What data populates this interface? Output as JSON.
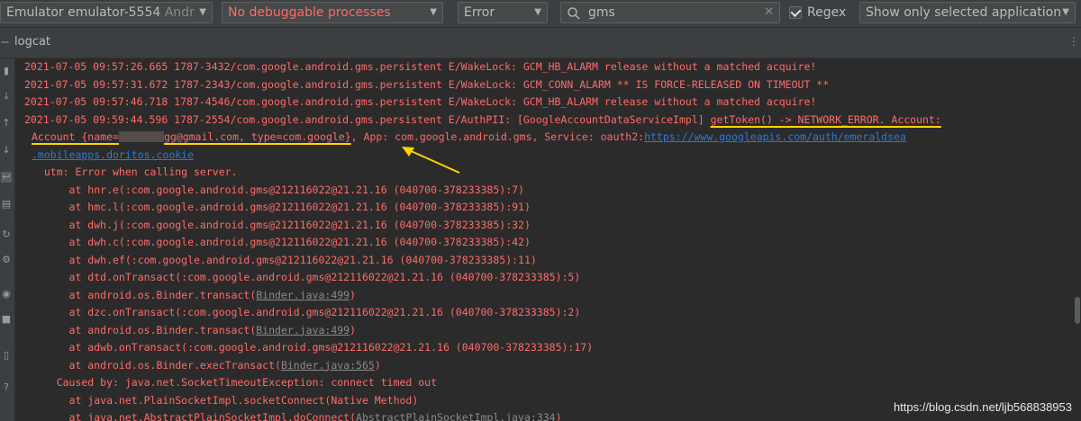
{
  "toolbar": {
    "device": "Emulator emulator-5554",
    "device_suffix": "Andr",
    "process": "No debuggable processes",
    "level": "Error",
    "search_value": "gms",
    "regex_label": "Regex",
    "filter": "Show only selected application"
  },
  "panel": {
    "tab_label": "logcat",
    "hide_glyph": "−"
  },
  "log": {
    "l1": "2021-07-05 09:57:26.665 1787-3432/com.google.android.gms.persistent E/WakeLock: GCM_HB_ALARM release without a matched acquire!",
    "l2": "2021-07-05 09:57:31.672 1787-2343/com.google.android.gms.persistent E/WakeLock: GCM_CONN_ALARM ** IS FORCE-RELEASED ON TIMEOUT **",
    "l3": "2021-07-05 09:57:46.718 1787-4546/com.google.android.gms.persistent E/WakeLock: GCM_HB_ALARM release without a matched acquire!",
    "l4a": "2021-07-05 09:59:44.596 1787-2554/com.google.android.gms.persistent E/AuthPII: [GoogleAccountDataServiceImpl] ",
    "l4b": "getToken() -> NETWORK_ERROR. Account:",
    "l5a": "Account {name=",
    "l5b": "gg@gmail.com, type=com.google}",
    "l5c": ", App: com.google.android.gms, Service: oauth2:",
    "l5link": "https://www.googleapis.com/auth/emeraldsea",
    "l6link": ".mobileapps.doritos.cookie",
    "l7": "  utm: Error when calling server.",
    "l8": "      at hnr.e(:com.google.android.gms@212116022@21.21.16 (040700-378233385):7)",
    "l9": "      at hmc.l(:com.google.android.gms@212116022@21.21.16 (040700-378233385):91)",
    "l10": "      at dwh.j(:com.google.android.gms@212116022@21.21.16 (040700-378233385):32)",
    "l11": "      at dwh.c(:com.google.android.gms@212116022@21.21.16 (040700-378233385):42)",
    "l12": "      at dwh.ef(:com.google.android.gms@212116022@21.21.16 (040700-378233385):11)",
    "l13": "      at dtd.onTransact(:com.google.android.gms@212116022@21.21.16 (040700-378233385):5)",
    "l14a": "      at android.os.Binder.transact(",
    "l14file": "Binder.java:499",
    "l14b": ")",
    "l15": "      at dzc.onTransact(:com.google.android.gms@212116022@21.21.16 (040700-378233385):2)",
    "l16a": "      at android.os.Binder.transact(",
    "l16file": "Binder.java:499",
    "l16b": ")",
    "l17": "      at adwb.onTransact(:com.google.android.gms@212116022@21.21.16 (040700-378233385):17)",
    "l18a": "      at android.os.Binder.execTransact(",
    "l18file": "Binder.java:565",
    "l18b": ")",
    "l19": "    Caused by: java.net.SocketTimeoutException: connect timed out",
    "l20": "      at java.net.PlainSocketImpl.socketConnect(Native Method)",
    "l21a": "      at java.net.AbstractPlainSocketImpl.doConnect(",
    "l21file": "AbstractPlainSocketImpl.java:334",
    "l21b": ")"
  },
  "watermark": "https://blog.csdn.net/ljb568838953",
  "colors": {
    "error": "#ff6b68",
    "link": "#287bde",
    "annotation": "#ffd400",
    "background": "#2b2b2b"
  },
  "icons": [
    "scroll-up-icon",
    "scroll-to-end-icon",
    "up-stack-icon",
    "soft-wrap-icon",
    "print-icon",
    "restart-icon",
    "settings-icon",
    "screenshot-icon",
    "screen-record-icon",
    "help-icon"
  ]
}
